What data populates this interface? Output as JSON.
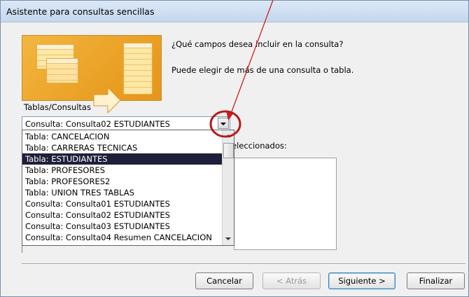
{
  "window": {
    "title": "Asistente para consultas sencillas"
  },
  "header": {
    "question": "¿Qué campos desea incluir en la consulta?",
    "hint": "Puede elegir de más de una consulta o tabla."
  },
  "source": {
    "label": "Tablas/Consultas",
    "selected_value": "Consulta: Consulta02 ESTUDIANTES",
    "options": [
      "Tabla: CANCELACION",
      "Tabla: CARRERAS TECNICAS",
      "Tabla: ESTUDIANTES",
      "Tabla: PROFESORES",
      "Tabla: PROFESORES2",
      "Tabla: UNION TRES TABLAS",
      "Consulta: Consulta01 ESTUDIANTES",
      "Consulta: Consulta02 ESTUDIANTES",
      "Consulta: Consulta03 ESTUDIANTES",
      "Consulta: Consulta04 Resumen  CANCELACION"
    ],
    "highlighted_option": "Tabla: ESTUDIANTES"
  },
  "selected_fields": {
    "label_fragment": "eleccionados:"
  },
  "buttons": {
    "cancel": "Cancelar",
    "back": "< Atrás",
    "next": "Siguiente >",
    "finish": "Finalizar"
  },
  "colors": {
    "annotation": "#cc1f1f",
    "highlight": "#1f1f3c"
  }
}
